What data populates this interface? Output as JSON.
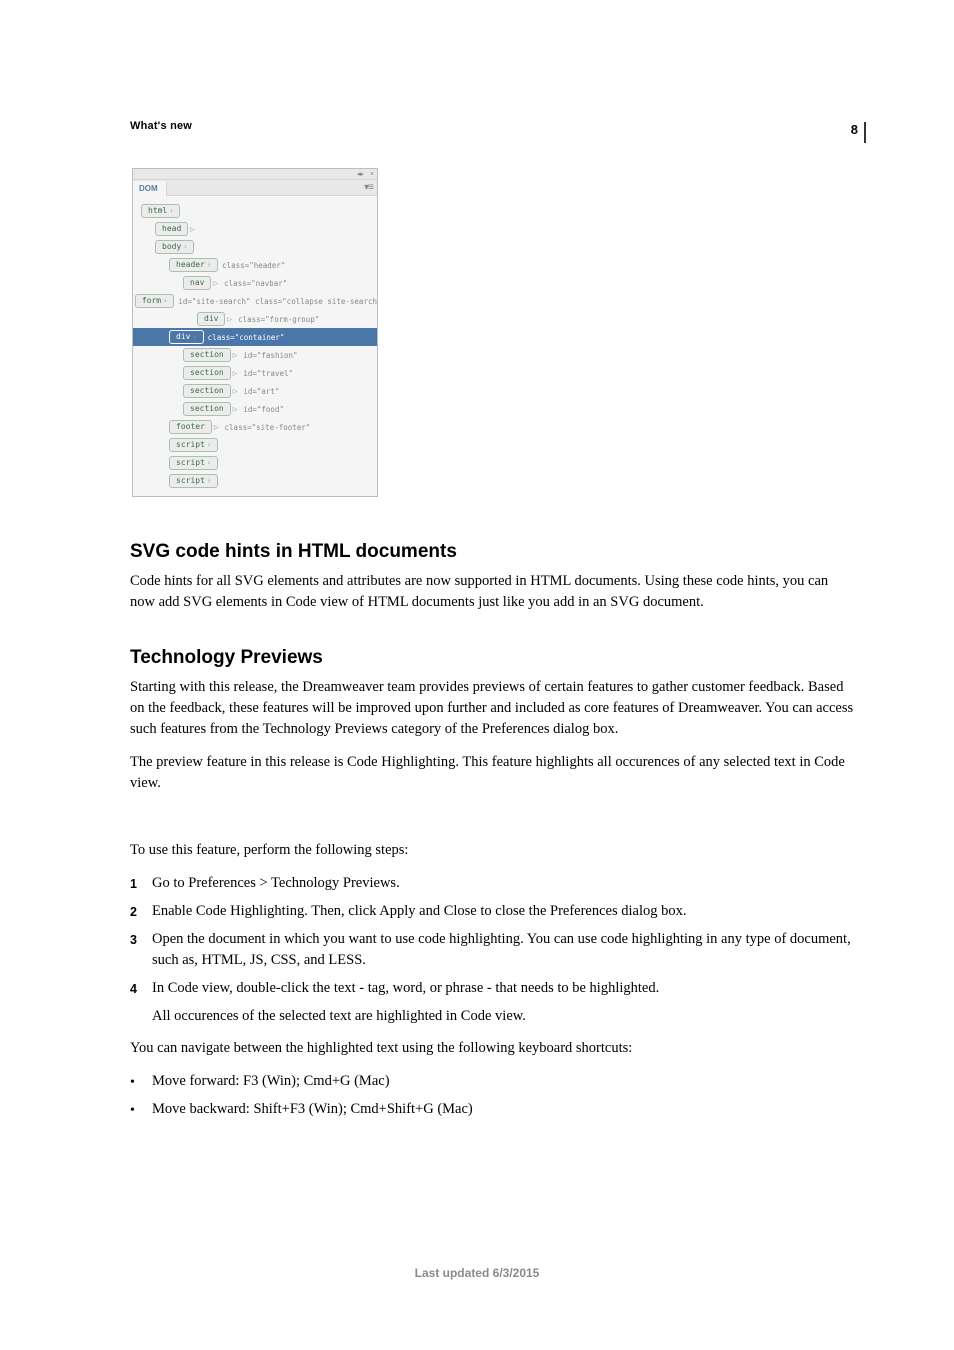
{
  "page_number": "8",
  "breadcrumb": "What's new",
  "footer": "Last updated 6/3/2015",
  "dom_panel": {
    "tab_label": "DOM",
    "titlebar_icons": {
      "expand": "◂▸",
      "close": "×"
    },
    "menu_icon": "▾≡",
    "rows": [
      {
        "indent": 8,
        "tag": "html",
        "caret": "›",
        "attr": "",
        "selected": false
      },
      {
        "indent": 22,
        "tag": "head",
        "caret": "",
        "attr": "",
        "expand": true,
        "selected": false
      },
      {
        "indent": 22,
        "tag": "body",
        "caret": "›",
        "attr": "",
        "selected": false
      },
      {
        "indent": 36,
        "tag": "header",
        "caret": "›",
        "attr": "class=\"header\"",
        "selected": false
      },
      {
        "indent": 50,
        "tag": "nav",
        "caret": "",
        "attr": "class=\"navbar\"",
        "expand": true,
        "selected": false
      },
      {
        "indent": 50,
        "tag": "form",
        "caret": "›",
        "attr": "id=\"site-search\" class=\"collapse site-search",
        "selected": false
      },
      {
        "indent": 64,
        "tag": "div",
        "caret": "",
        "attr": "class=\"form-group\"",
        "expand": true,
        "selected": false
      },
      {
        "indent": 36,
        "tag": "div",
        "caret": "›",
        "attr": "class=\"container\"",
        "selected": true
      },
      {
        "indent": 50,
        "tag": "section",
        "caret": "",
        "attr": "id=\"fashion\"",
        "expand": true,
        "selected": false
      },
      {
        "indent": 50,
        "tag": "section",
        "caret": "",
        "attr": "id=\"travel\"",
        "expand": true,
        "selected": false
      },
      {
        "indent": 50,
        "tag": "section",
        "caret": "",
        "attr": "id=\"art\"",
        "expand": true,
        "selected": false
      },
      {
        "indent": 50,
        "tag": "section",
        "caret": "",
        "attr": "id=\"food\"",
        "expand": true,
        "selected": false
      },
      {
        "indent": 36,
        "tag": "footer",
        "caret": "",
        "attr": "class=\"site-footer\"",
        "expand": true,
        "selected": false
      },
      {
        "indent": 36,
        "tag": "script",
        "caret": "›",
        "attr": "",
        "selected": false
      },
      {
        "indent": 36,
        "tag": "script",
        "caret": "›",
        "attr": "",
        "selected": false
      },
      {
        "indent": 36,
        "tag": "script",
        "caret": "›",
        "attr": "",
        "selected": false
      }
    ]
  },
  "sections": {
    "svg": {
      "heading": "SVG code hints in HTML documents",
      "p1": "Code hints for all SVG elements and attributes are now supported in HTML documents. Using these code hints, you can now add SVG elements in Code view of HTML documents just like you add in an SVG document."
    },
    "tech": {
      "heading": "Technology Previews",
      "p1": "Starting with this release, the Dreamweaver team provides previews of certain features to gather customer feedback. Based on the feedback, these features will be improved upon further and included as core features of Dreamweaver. You can access such features from the Technology Previews category of the Preferences dialog box.",
      "p2": "The preview feature in this release is Code Highlighting. This feature highlights all occurences of any selected text in Code view.",
      "steps_intro": "To use this feature, perform the following steps:",
      "step1": "Go to Preferences > Technology Previews.",
      "step2": "Enable Code Highlighting. Then, click Apply and Close to close the Preferences dialog box.",
      "step3": "Open the document in which you want to use code highlighting. You can use code highlighting in any type of document, such as, HTML, JS, CSS, and LESS.",
      "step4": "In Code view, double-click the text - tag, word, or phrase - that needs to be highlighted.",
      "step4_sub": "All occurences of the selected text are highlighted in Code view.",
      "nav_intro": "You can navigate between the highlighted text using the following keyboard shortcuts:",
      "nav1": "Move forward: F3 (Win); Cmd+G (Mac)",
      "nav2": "Move backward: Shift+F3 (Win); Cmd+Shift+G (Mac)",
      "numbers": {
        "n1": "1",
        "n2": "2",
        "n3": "3",
        "n4": "4"
      },
      "bullet": "•"
    }
  }
}
